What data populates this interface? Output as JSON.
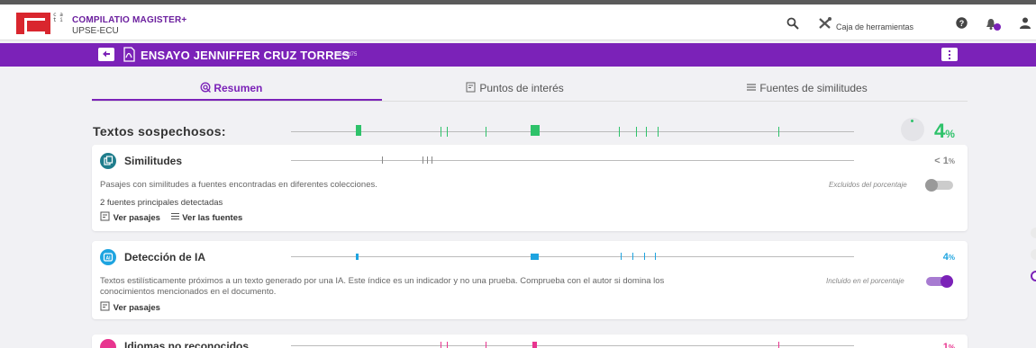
{
  "app": {
    "brand_name": "COMPILATIO MAGISTER+",
    "org": "UPSE-ECU",
    "logo_side_text": "c a t i",
    "toolbox_label": "Caja de herramientas"
  },
  "document": {
    "title": "ENSAYO JENNIFFER CRUZ TORRES",
    "tag": "#5eed75"
  },
  "tabs": [
    {
      "label": "Resumen",
      "icon": "target-icon",
      "active": true
    },
    {
      "label": "Puntos de interés",
      "icon": "document-search-icon",
      "active": false
    },
    {
      "label": "Fuentes de similitudes",
      "icon": "list-icon",
      "active": false
    }
  ],
  "summary": {
    "label": "Textos sospechosos:",
    "percent": "4",
    "percent_sign": "%",
    "color": "#2ec26a"
  },
  "cards": {
    "similarities": {
      "title": "Similitudes",
      "percent": "< 1",
      "percent_sign": "%",
      "description": "Pasajes con similitudes a fuentes encontradas en diferentes colecciones.",
      "sources_text": "2 fuentes principales detectadas",
      "link_passages": "Ver pasajes",
      "link_sources": "Ver las fuentes",
      "toggle_label": "Excluidos del porcentaje",
      "toggle_on": false,
      "color": "#1f7d8c"
    },
    "ai_detection": {
      "title": "Detección de IA",
      "percent": "4",
      "percent_sign": "%",
      "description_line1": "Textos estilísticamente próximos a un texto generado por una IA. Este índice es un indicador y no una prueba. Comprueba con el autor si domina los",
      "description_line2": "conocimientos mencionados en el documento.",
      "link_passages": "Ver pasajes",
      "toggle_label": "Incluido en el porcentaje",
      "toggle_on": true,
      "color": "#1ea4e0"
    },
    "languages": {
      "title": "Idiomas no reconocidos",
      "percent": "1",
      "percent_sign": "%",
      "color": "#e8358f"
    }
  },
  "colors": {
    "purple": "#7b22b8",
    "green": "#2ec26a",
    "blue": "#1ea4e0",
    "pink": "#e8358f",
    "teal": "#1f7d8c"
  }
}
